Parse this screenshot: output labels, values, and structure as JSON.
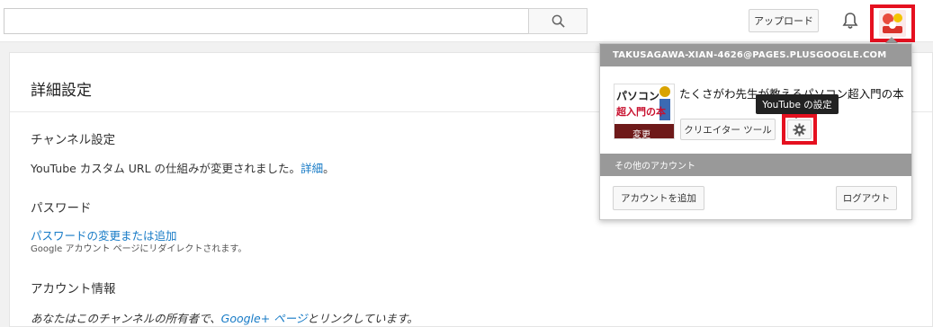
{
  "header": {
    "search_placeholder": "",
    "upload_label": "アップロード"
  },
  "settings": {
    "page_title": "詳細設定",
    "channel": {
      "heading": "チャンネル設定",
      "text": "YouTube カスタム URL の仕組みが変更されました。",
      "link": "詳細",
      "suffix": "。"
    },
    "password": {
      "heading": "パスワード",
      "link": "パスワードの変更または追加",
      "note": "Google アカウント ページにリダイレクトされます。"
    },
    "account_info": {
      "heading": "アカウント情報",
      "text_pre": "あなたはこのチャンネルの所有者で、",
      "link": "Google+ ページ",
      "text_post": "とリンクしています。"
    }
  },
  "account_popup": {
    "email": "TAKUSAGAWA-XIAN-4626@PAGES.PLUSGOOGLE.COM",
    "channel_name": "たくさがわ先生が教えるパソコン超入門の本",
    "thumb_text_1": "パソコン",
    "thumb_text_2": "超入門の本",
    "change_label": "変更",
    "creator_tools_label": "クリエイター ツール",
    "tooltip": "YouTube の設定",
    "other_accounts": "その他のアカウント",
    "add_account_label": "アカウントを追加",
    "logout_label": "ログアウト"
  },
  "colors": {
    "highlight": "#e5101f",
    "link": "#167ac6",
    "popup_header": "#999999"
  }
}
